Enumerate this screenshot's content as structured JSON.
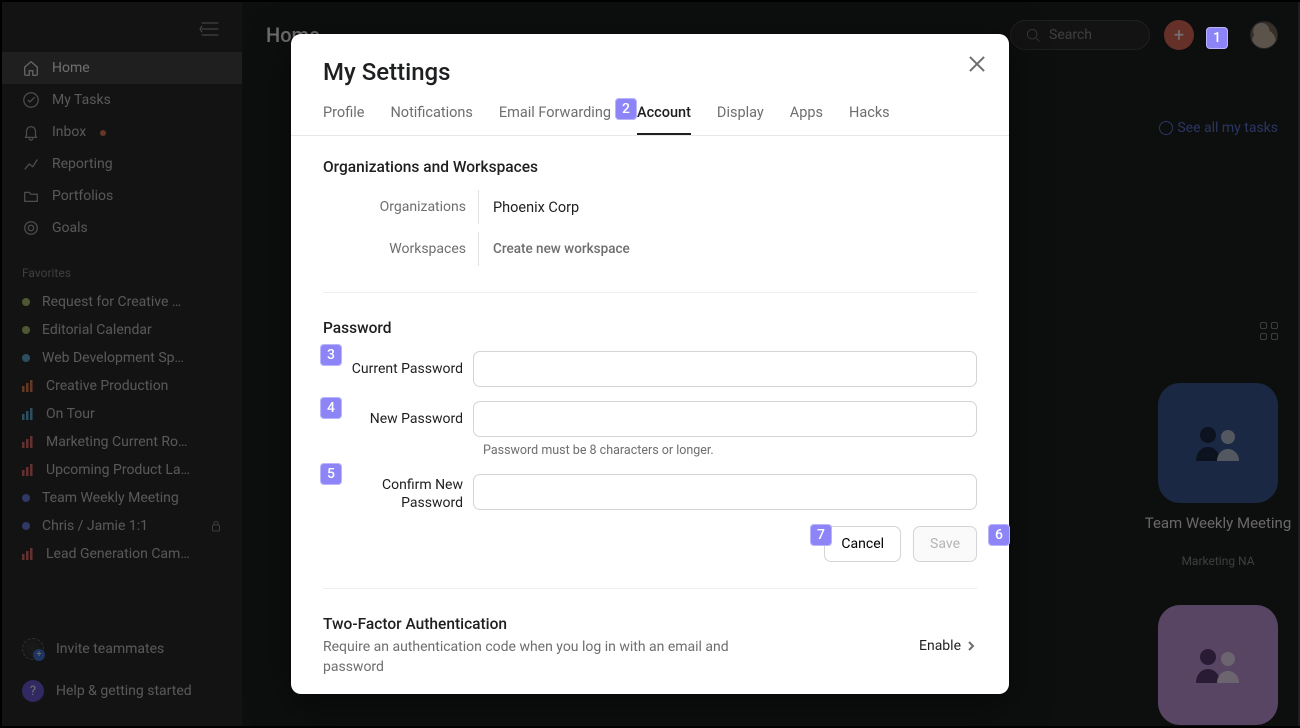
{
  "sidebar": {
    "nav": [
      {
        "label": "Home",
        "icon": "home",
        "active": true
      },
      {
        "label": "My Tasks",
        "icon": "check"
      },
      {
        "label": "Inbox",
        "icon": "bell",
        "dot": true
      },
      {
        "label": "Reporting",
        "icon": "chart"
      },
      {
        "label": "Portfolios",
        "icon": "folder"
      },
      {
        "label": "Goals",
        "icon": "target"
      }
    ],
    "favorites_label": "Favorites",
    "favorites": [
      {
        "label": "Request for Creative …",
        "type": "dot",
        "color": "#aac46b"
      },
      {
        "label": "Editorial Calendar",
        "type": "dot",
        "color": "#aac46b"
      },
      {
        "label": "Web Development Sp…",
        "type": "dot",
        "color": "#61b0d4"
      },
      {
        "label": "Creative Production",
        "type": "bars",
        "color": "#e07b52"
      },
      {
        "label": "On Tour",
        "type": "bars",
        "color": "#61b0d4"
      },
      {
        "label": "Marketing Current Ro…",
        "type": "bars",
        "color": "#de6b6b"
      },
      {
        "label": "Upcoming Product La…",
        "type": "bars",
        "color": "#de6b6b"
      },
      {
        "label": "Team Weekly Meeting",
        "type": "dot",
        "color": "#6a7ce0"
      },
      {
        "label": "Chris / Jamie 1:1",
        "type": "dot",
        "color": "#6a7ce0",
        "lock": true
      },
      {
        "label": "Lead Generation Cam…",
        "type": "bars",
        "color": "#de6b6b"
      }
    ],
    "invite_label": "Invite teammates",
    "help_label": "Help & getting started"
  },
  "header": {
    "title": "Home",
    "search_placeholder": "Search",
    "see_all_link": "See all my tasks"
  },
  "bg_card": {
    "title": "Team Weekly Meeting",
    "subtitle": "Marketing NA"
  },
  "modal": {
    "title": "My Settings",
    "tabs": [
      "Profile",
      "Notifications",
      "Email Forwarding",
      "Account",
      "Display",
      "Apps",
      "Hacks"
    ],
    "active_tab": "Account",
    "org_section": "Organizations and Workspaces",
    "org_label": "Organizations",
    "org_value": "Phoenix Corp",
    "ws_label": "Workspaces",
    "ws_action": "Create new workspace",
    "pw_section": "Password",
    "pw_current": "Current Password",
    "pw_new": "New Password",
    "pw_hint": "Password must be 8 characters or longer.",
    "pw_confirm": "Confirm New Password",
    "btn_cancel": "Cancel",
    "btn_save": "Save",
    "tfa_title": "Two-Factor Authentication",
    "tfa_desc": "Require an authentication code when you log in with an email and password",
    "tfa_enable": "Enable"
  },
  "badges": [
    "1",
    "2",
    "3",
    "4",
    "5",
    "6",
    "7"
  ]
}
